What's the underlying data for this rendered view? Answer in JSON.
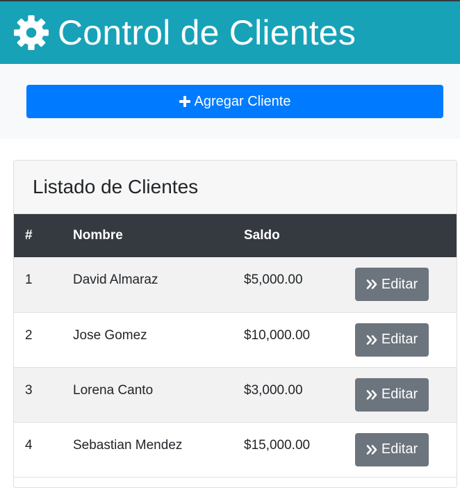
{
  "header": {
    "title": "Control de Clientes",
    "icon": "gear-icon"
  },
  "actions": {
    "add_label": "Agregar Cliente",
    "add_icon": "plus-icon"
  },
  "list": {
    "title": "Listado de Clientes",
    "columns": [
      "#",
      "Nombre",
      "Saldo",
      ""
    ],
    "rows": [
      {
        "num": "1",
        "name": "David Almaraz",
        "balance": "$5,000.00",
        "action": "Editar"
      },
      {
        "num": "2",
        "name": "Jose Gomez",
        "balance": "$10,000.00",
        "action": "Editar"
      },
      {
        "num": "3",
        "name": "Lorena Canto",
        "balance": "$3,000.00",
        "action": "Editar"
      },
      {
        "num": "4",
        "name": "Sebastian Mendez",
        "balance": "$15,000.00",
        "action": "Editar"
      }
    ],
    "edit_icon": "angle-double-right-icon"
  },
  "colors": {
    "header_bg": "#17a2b8",
    "primary": "#007bff",
    "secondary": "#6c757d",
    "table_head_bg": "#343a40"
  }
}
